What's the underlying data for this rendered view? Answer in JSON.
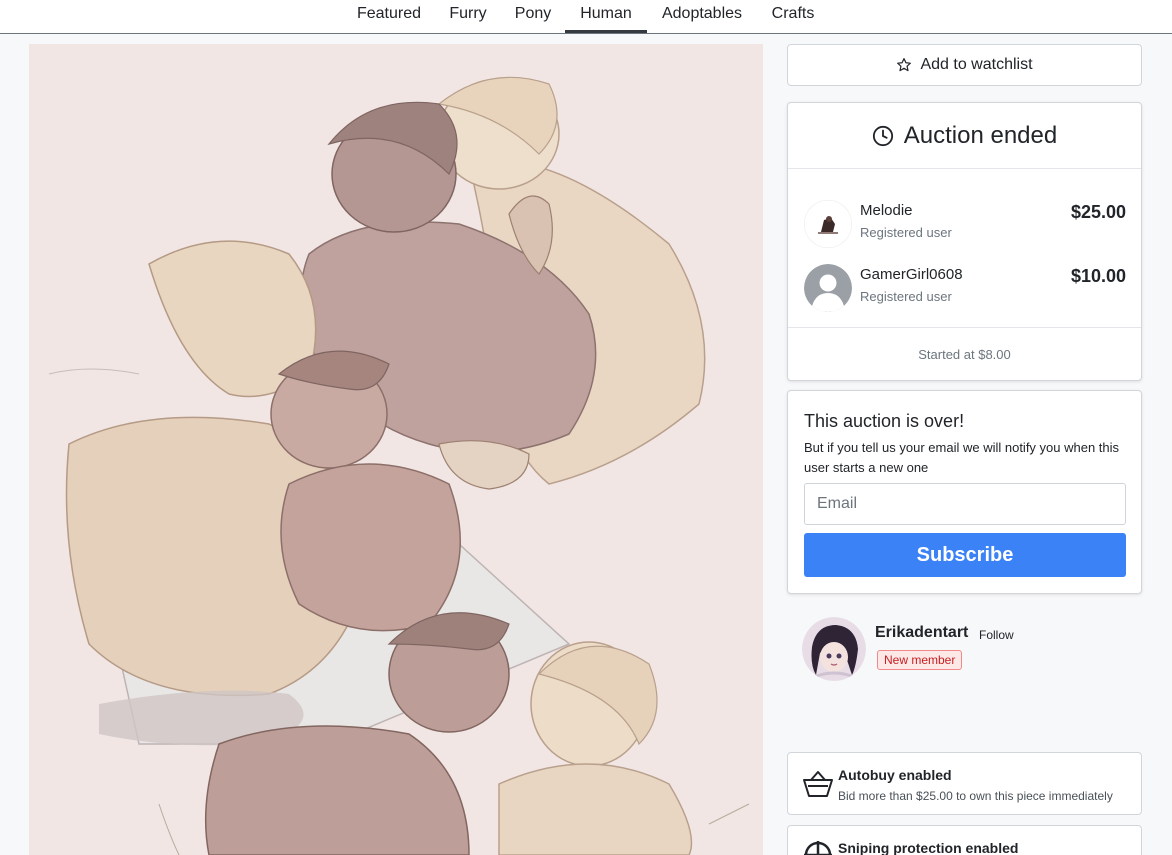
{
  "nav": {
    "tabs": [
      {
        "label": "Featured"
      },
      {
        "label": "Furry"
      },
      {
        "label": "Pony"
      },
      {
        "label": "Human",
        "active": true
      },
      {
        "label": "Adoptables"
      },
      {
        "label": "Crafts"
      }
    ]
  },
  "watchlist": {
    "label": "Add to watchlist",
    "icon": "star-icon"
  },
  "auction": {
    "status": "Auction ended",
    "icon": "clock-icon",
    "bids": [
      {
        "name": "Melodie",
        "role": "Registered user",
        "amount": "$25.00"
      },
      {
        "name": "GamerGirl0608",
        "role": "Registered user",
        "amount": "$10.00"
      }
    ],
    "started_at": "Started at $8.00"
  },
  "notify": {
    "title": "This auction is over!",
    "description": "But if you tell us your email we will notify you when this user starts a new one",
    "email_placeholder": "Email",
    "subscribe_label": "Subscribe"
  },
  "artist": {
    "username": "Erikadentart",
    "follow_label": "Follow",
    "badge": "New member"
  },
  "features": [
    {
      "title": "Autobuy enabled",
      "description": "Bid more than $25.00 to own this piece immediately",
      "icon": "basket-icon"
    },
    {
      "title": "Sniping protection enabled",
      "icon": "crosshair-icon"
    }
  ],
  "colors": {
    "accent": "#3b82f6",
    "badge_text": "#c81e1e",
    "badge_bg": "#fde8e8",
    "artwork_bg": "#f1e6e4"
  }
}
